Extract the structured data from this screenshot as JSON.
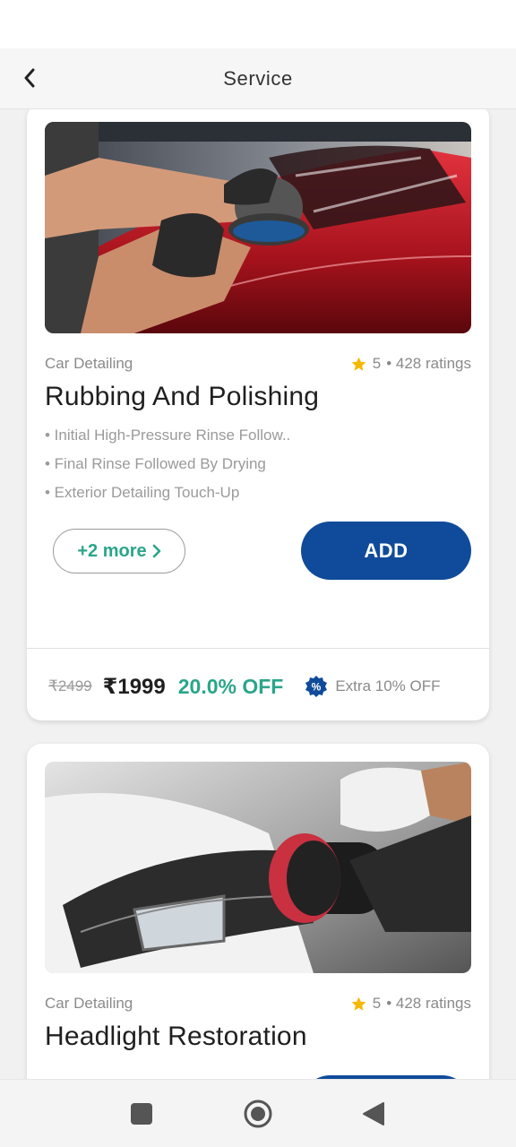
{
  "header": {
    "title": "Service"
  },
  "cards": [
    {
      "category": "Car Detailing",
      "rating_value": "5",
      "rating_text": "• 428 ratings",
      "title": "Rubbing And Polishing",
      "bullets": [
        "• Initial High-Pressure Rinse Follow..",
        "• Final Rinse Followed By Drying",
        "• Exterior Detailing Touch-Up"
      ],
      "more_label": "+2 more",
      "add_label": "ADD",
      "price_original": "₹2499",
      "price_current": "₹1999",
      "discount": "20.0% OFF",
      "extra_offer": "Extra 10% OFF",
      "image_icon": "car-polishing-photo"
    },
    {
      "category": "Car Detailing",
      "rating_value": "5",
      "rating_text": "• 428 ratings",
      "title": "Headlight Restoration",
      "image_icon": "headlight-polishing-photo"
    }
  ],
  "nav": {
    "recents_icon": "square-icon",
    "home_icon": "circle-icon",
    "back_icon": "triangle-back-icon"
  },
  "colors": {
    "accent": "#0f4b9a",
    "discount_green": "#2aa58a",
    "star": "#f5b800"
  }
}
